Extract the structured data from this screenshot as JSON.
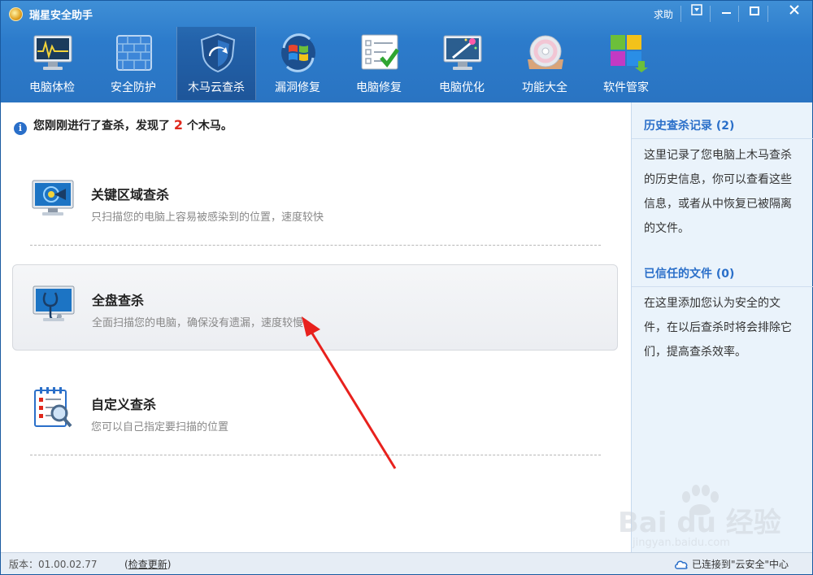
{
  "app": {
    "title": "瑞星安全助手",
    "help_label": "求助"
  },
  "toolbar": [
    {
      "label": "电脑体检",
      "icon": "monitor-checkup-icon"
    },
    {
      "label": "安全防护",
      "icon": "firewall-icon"
    },
    {
      "label": "木马云查杀",
      "icon": "shield-icon",
      "active": true
    },
    {
      "label": "漏洞修复",
      "icon": "windows-update-icon"
    },
    {
      "label": "电脑修复",
      "icon": "checklist-icon"
    },
    {
      "label": "电脑优化",
      "icon": "magic-wand-icon"
    },
    {
      "label": "功能大全",
      "icon": "disc-icon"
    },
    {
      "label": "软件管家",
      "icon": "software-blocks-icon"
    }
  ],
  "notice": {
    "prefix": "您刚刚进行了查杀，发现了",
    "count": "2",
    "suffix": "个木马。"
  },
  "scan_options": [
    {
      "title": "关键区域查杀",
      "desc": "只扫描您的电脑上容易被感染到的位置，速度较快"
    },
    {
      "title": "全盘查杀",
      "desc": "全面扫描您的电脑，确保没有遗漏，速度较慢"
    },
    {
      "title": "自定义查杀",
      "desc": "您可以自己指定要扫描的位置"
    }
  ],
  "sidebar": {
    "history_title": "历史查杀记录 (2)",
    "history_text": "这里记录了您电脑上木马查杀的历史信息，你可以查看这些信息，或者从中恢复已被隔离的文件。",
    "trusted_title": "已信任的文件 (0)",
    "trusted_text": "在这里添加您认为安全的文件，在以后查杀时将会排除它们，提高查杀效率。"
  },
  "status": {
    "version": "版本：01.00.02.77",
    "update_link": "检查更新",
    "cloud": "已连接到\"云安全\"中心"
  },
  "watermark": {
    "brand": "Bai du 经验",
    "url": "jingyan.baidu.com"
  },
  "colors": {
    "header": "#2c7bcb",
    "accent": "#2a6fc9",
    "count_red": "#e0281c",
    "arrow_red": "#e8211d"
  }
}
